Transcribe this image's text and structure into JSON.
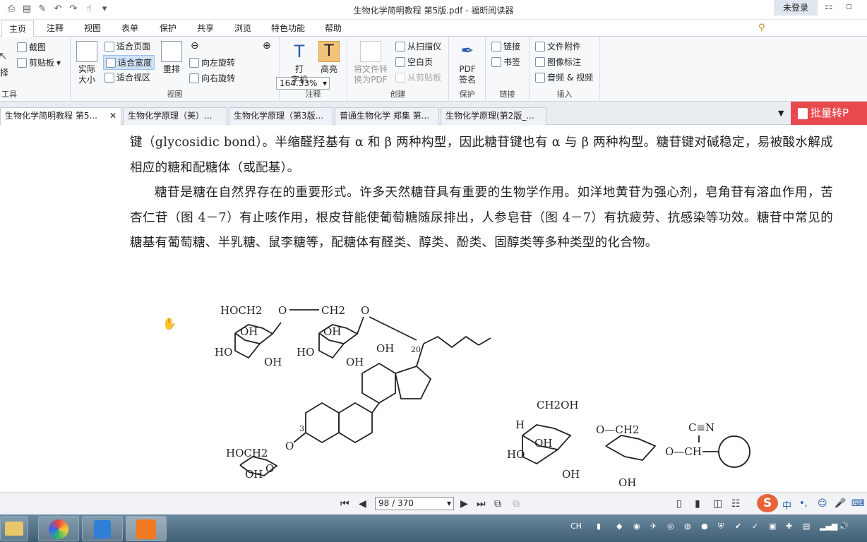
{
  "window": {
    "title": "生物化学简明教程 第5版.pdf - 福昕阅读器",
    "login": "未登录"
  },
  "menu": {
    "tabs": [
      "主页",
      "注释",
      "视图",
      "表单",
      "保护",
      "共享",
      "浏览",
      "特色功能",
      "帮助"
    ],
    "search_placeholder": "查找"
  },
  "ribbon": {
    "tools": {
      "label": "工具",
      "cut": "截图",
      "clipboard": "剪贴板",
      "select": "择"
    },
    "view": {
      "label": "视图",
      "actual_size": "实际\n大小",
      "fit_page": "适合页面",
      "fit_width": "适合宽度",
      "fit_view": "适合视区",
      "reflow": "重排",
      "zoom": "164.33%",
      "rotate_left": "向左旋转",
      "rotate_right": "向右旋转"
    },
    "annotate": {
      "label": "注释",
      "typewriter": "打\n字机",
      "highlight": "高亮"
    },
    "create": {
      "label": "创建",
      "convert": "将文件转\n换为PDF",
      "from_scanner": "从扫描仪",
      "blank_page": "空白页",
      "from_clipboard": "从剪贴板"
    },
    "protect": {
      "label": "保护",
      "pdf_sign": "PDF\n签名"
    },
    "links": {
      "label": "链接",
      "link": "链接",
      "bookmark": "书签"
    },
    "insert": {
      "label": "插入",
      "attachment": "文件附件",
      "image_mark": "图像标注",
      "audio_video": "音频 & 视频"
    }
  },
  "doc_tabs": [
    "生物化学简明教程 第5...",
    "生物化学原理（美）...",
    "生物化学原理（第3版...",
    "普通生物化学 郑集 第...",
    "生物化学原理(第2版_..."
  ],
  "batch_button": "批量转P",
  "content": {
    "p1": "键（glycosidic bond）。半缩醛羟基有 α 和 β 两种构型，因此糖苷键也有 α 与 β 两种构型。糖苷键对碱稳定，易被酸水解成相应的糖和配糖体（或配基）。",
    "p2": "糖苷是糖在自然界存在的重要形式。许多天然糖苷具有重要的生物学作用。如洋地黄苷为强心剂，皂角苷有溶血作用，苦杏仁苷（图 4－7）有止咳作用，根皮苷能使葡萄糖随尿排出，人参皂苷（图 4－7）有抗疲劳、抗感染等功效。糖苷中常见的糖基有葡萄糖、半乳糖、鼠李糖等，配糖体有醛类、醇类、酚类、固醇类等多种类型的化合物。",
    "chem_labels": {
      "hoch2_a": "HOCH2",
      "o_bridge": "O",
      "ch2_a": "CH2",
      "o_glyc": "O",
      "oh": "OH",
      "ho": "HO",
      "twenty": "20",
      "three": "3",
      "ch2oh": "CH2OH",
      "h": "H",
      "o_ch2": "O—CH2",
      "cn": "C≡N",
      "o_ch": "O—CH"
    }
  },
  "status": {
    "page": "98 / 370"
  },
  "taskbar": {
    "ime": "CH"
  },
  "ime_bar": [
    "中",
    "•,"
  ]
}
